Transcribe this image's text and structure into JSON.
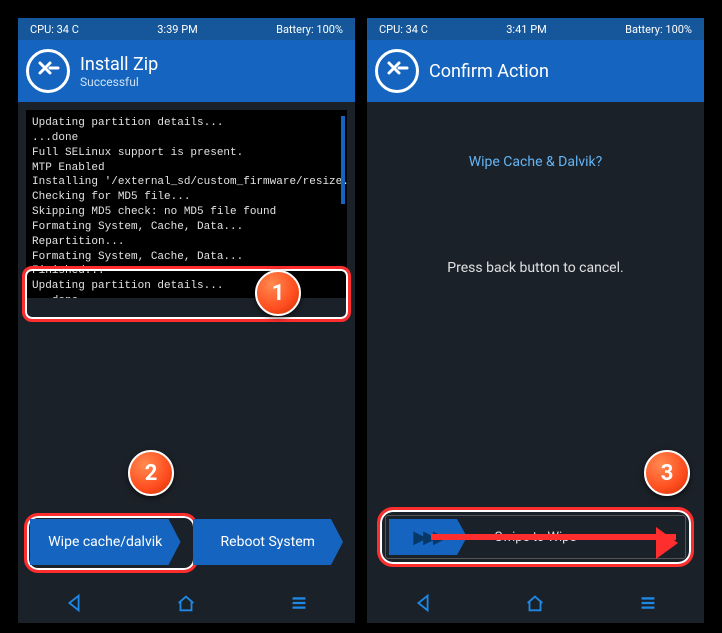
{
  "left": {
    "status": {
      "cpu": "CPU: 34 C",
      "time": "3:39 PM",
      "batt": "Battery: 100%"
    },
    "title": "Install Zip",
    "subtitle": "Successful",
    "log": "Updating partition details...\n...done\nFull SELinux support is present.\nMTP Enabled\nInstalling '/external_sd/custom_firmware/resize.zip'...\nChecking for MD5 file...\nSkipping MD5 check: no MD5 file found\nFormating System, Cache, Data...\nRepartition...\nFormating System, Cache, Data...\nFinished...\nUpdating partition details...\n...done",
    "btn_wipe": "Wipe cache/dalvik",
    "btn_reboot": "Reboot System"
  },
  "right": {
    "status": {
      "cpu": "CPU: 34 C",
      "time": "3:41 PM",
      "batt": "Battery: 100%"
    },
    "title": "Confirm Action",
    "question": "Wipe Cache & Dalvik?",
    "hint": "Press back button to cancel.",
    "swipe": "Swipe to Wipe"
  },
  "badges": {
    "b1": "1",
    "b2": "2",
    "b3": "3"
  }
}
